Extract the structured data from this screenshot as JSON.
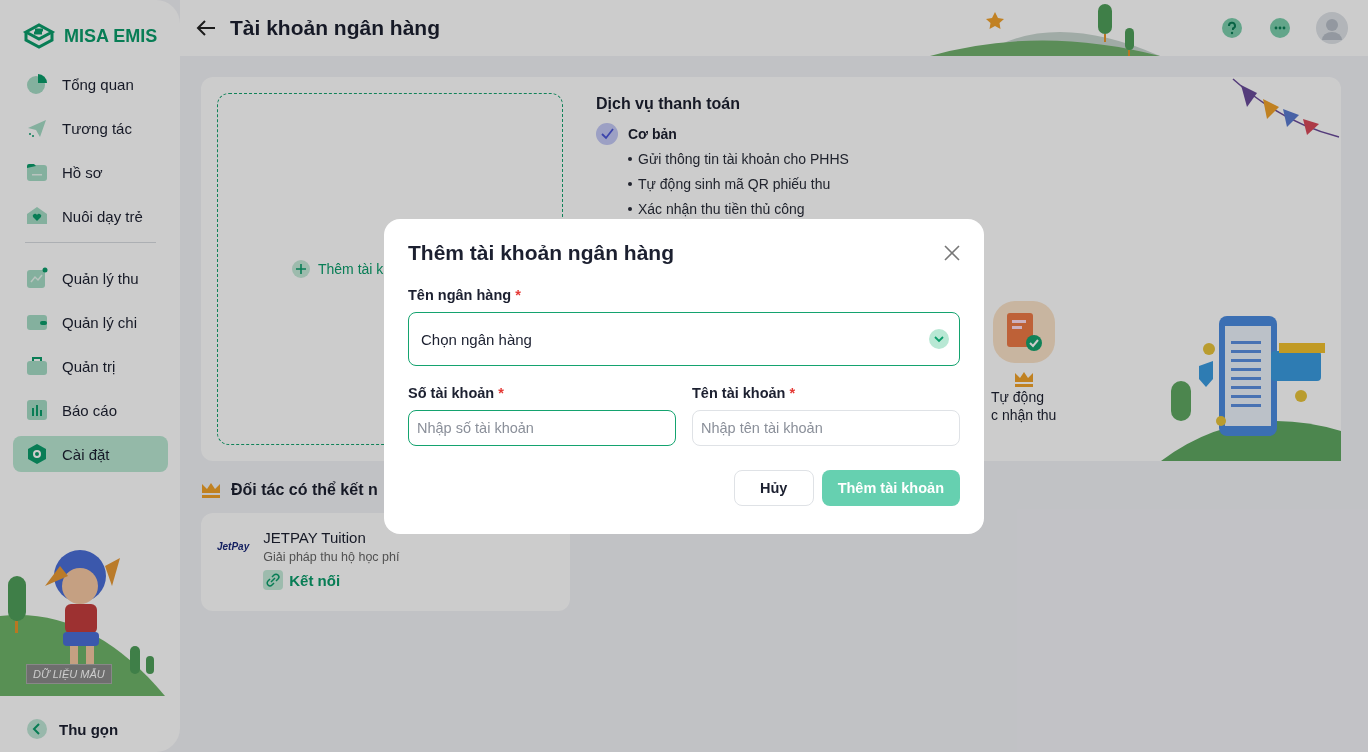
{
  "sidebar": {
    "logo": "MISA EMIS",
    "groups": [
      {
        "items": [
          {
            "label": "Tổng quan",
            "selected": false
          },
          {
            "label": "Tương tác",
            "selected": false
          },
          {
            "label": "Hồ sơ",
            "selected": false
          },
          {
            "label": "Nuôi dạy trẻ",
            "selected": false
          }
        ]
      },
      {
        "items": [
          {
            "label": "Quản lý thu",
            "selected": false
          },
          {
            "label": "Quản lý chi",
            "selected": false
          },
          {
            "label": "Quản trị",
            "selected": false
          },
          {
            "label": "Báo cáo",
            "selected": false
          },
          {
            "label": "Cài đặt",
            "selected": true
          }
        ]
      }
    ],
    "stamp": "DỮ LIỆU MẪU",
    "collapse": "Thu gọn"
  },
  "header": {
    "title": "Tài khoản ngân hàng"
  },
  "add_account": {
    "label": "Thêm tài k"
  },
  "services": {
    "title": "Dịch vụ thanh toán",
    "plans": [
      {
        "name": "Cơ bản",
        "checked": true,
        "features": [
          "Gửi thông tin tài khoản cho PHHS",
          "Tự động sinh mã QR phiếu thu",
          "Xác nhận thu tiền thủ công"
        ]
      }
    ],
    "advanced_lines": [
      "Tự động",
      "c nhận thu"
    ]
  },
  "partners": {
    "title": "Đối tác có thể kết n",
    "items": [
      {
        "logo": "JetPay",
        "name": "JETPAY Tuition",
        "description": "Giải pháp thu hộ học phí",
        "action": "Kết nối"
      }
    ]
  },
  "dialog": {
    "title": "Thêm tài khoản ngân hàng",
    "bank": {
      "label": "Tên ngân hàng",
      "required_mark": "*",
      "placeholder": "Chọn ngân hàng"
    },
    "fields": [
      {
        "label": "Số tài khoản",
        "required_mark": "*",
        "placeholder": "Nhập số tài khoản",
        "focused": true
      },
      {
        "label": "Tên tài khoản",
        "required_mark": "*",
        "placeholder": "Nhập tên tài khoản",
        "focused": false
      }
    ],
    "buttons": [
      {
        "label": "Hủy",
        "kind": "secondary"
      },
      {
        "label": "Thêm tài khoản",
        "kind": "primary",
        "disabled": true
      }
    ]
  }
}
